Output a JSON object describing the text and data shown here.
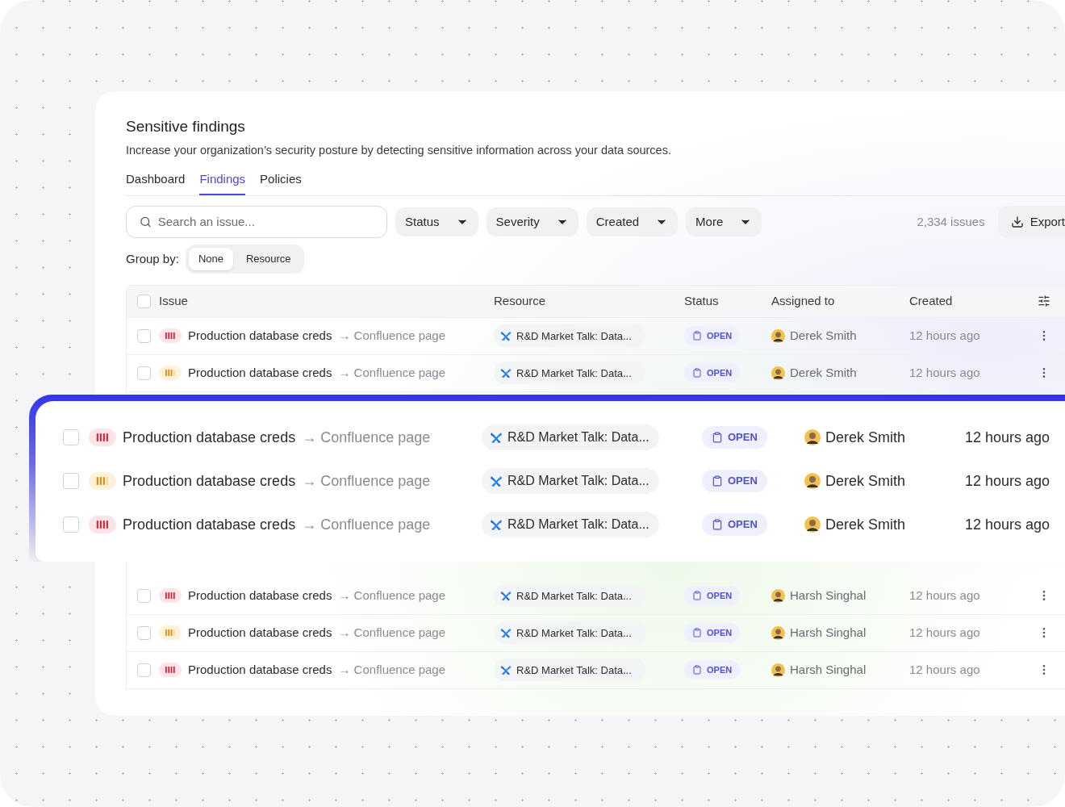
{
  "header": {
    "title": "Sensitive findings",
    "description": "Increase your organization’s security posture by detecting sensitive information across your data sources."
  },
  "tabs": [
    {
      "label": "Dashboard",
      "selected": false
    },
    {
      "label": "Findings",
      "selected": true
    },
    {
      "label": "Policies",
      "selected": false
    }
  ],
  "search": {
    "placeholder": "Search an issue..."
  },
  "filters": [
    "Status",
    "Severity",
    "Created",
    "More"
  ],
  "issue_count": "2,334 issues",
  "export_button": "Export",
  "group_by": {
    "label": "Group by:",
    "options": [
      {
        "label": "None",
        "selected": true
      },
      {
        "label": "Resource",
        "selected": false
      }
    ]
  },
  "table": {
    "select_all_checked": false,
    "columns": [
      "Issue",
      "Resource",
      "Status",
      "Assigned to",
      "Created"
    ],
    "rows_top": [
      {
        "kind": "critical",
        "issue": "Production database creds",
        "target": "→ Confluence page",
        "resource": "R&D Market Talk: Data...",
        "status": "OPEN",
        "assignee": "Derek Smith",
        "created": "12 hours ago",
        "checked": false
      },
      {
        "kind": "high",
        "issue": "Production database creds",
        "target": "→ Confluence page",
        "resource": "R&D Market Talk: Data...",
        "status": "OPEN",
        "assignee": "Derek Smith",
        "created": "12 hours ago",
        "checked": false
      }
    ],
    "rows_bottom": [
      {
        "kind": "critical",
        "issue": "Production database creds",
        "target": "→ Confluence page",
        "resource": "R&D Market Talk: Data...",
        "status": "OPEN",
        "assignee": "Harsh Singhal",
        "created": "12 hours ago",
        "checked": false
      },
      {
        "kind": "high",
        "issue": "Production database creds",
        "target": "→ Confluence page",
        "resource": "R&D Market Talk: Data...",
        "status": "OPEN",
        "assignee": "Harsh Singhal",
        "created": "12 hours ago",
        "checked": false
      },
      {
        "kind": "critical",
        "issue": "Production database creds",
        "target": "→ Confluence page",
        "resource": "R&D Market Talk: Data...",
        "status": "OPEN",
        "assignee": "Harsh Singhal",
        "created": "12 hours ago",
        "checked": false
      }
    ]
  },
  "highlight": {
    "rows": [
      {
        "kind": "critical",
        "issue": "Production database creds",
        "target": "→ Confluence page",
        "resource": "R&D Market Talk: Data...",
        "status": "OPEN",
        "assignee": "Derek Smith",
        "created": "12 hours ago",
        "checked": false
      },
      {
        "kind": "high",
        "issue": "Production database creds",
        "target": "→ Confluence page",
        "resource": "R&D Market Talk: Data...",
        "status": "OPEN",
        "assignee": "Derek Smith",
        "created": "12 hours ago",
        "checked": false
      },
      {
        "kind": "critical",
        "issue": "Production database creds",
        "target": "→ Confluence page",
        "resource": "R&D Market Talk: Data...",
        "status": "OPEN",
        "assignee": "Derek Smith",
        "created": "12 hours ago",
        "checked": false
      }
    ]
  }
}
